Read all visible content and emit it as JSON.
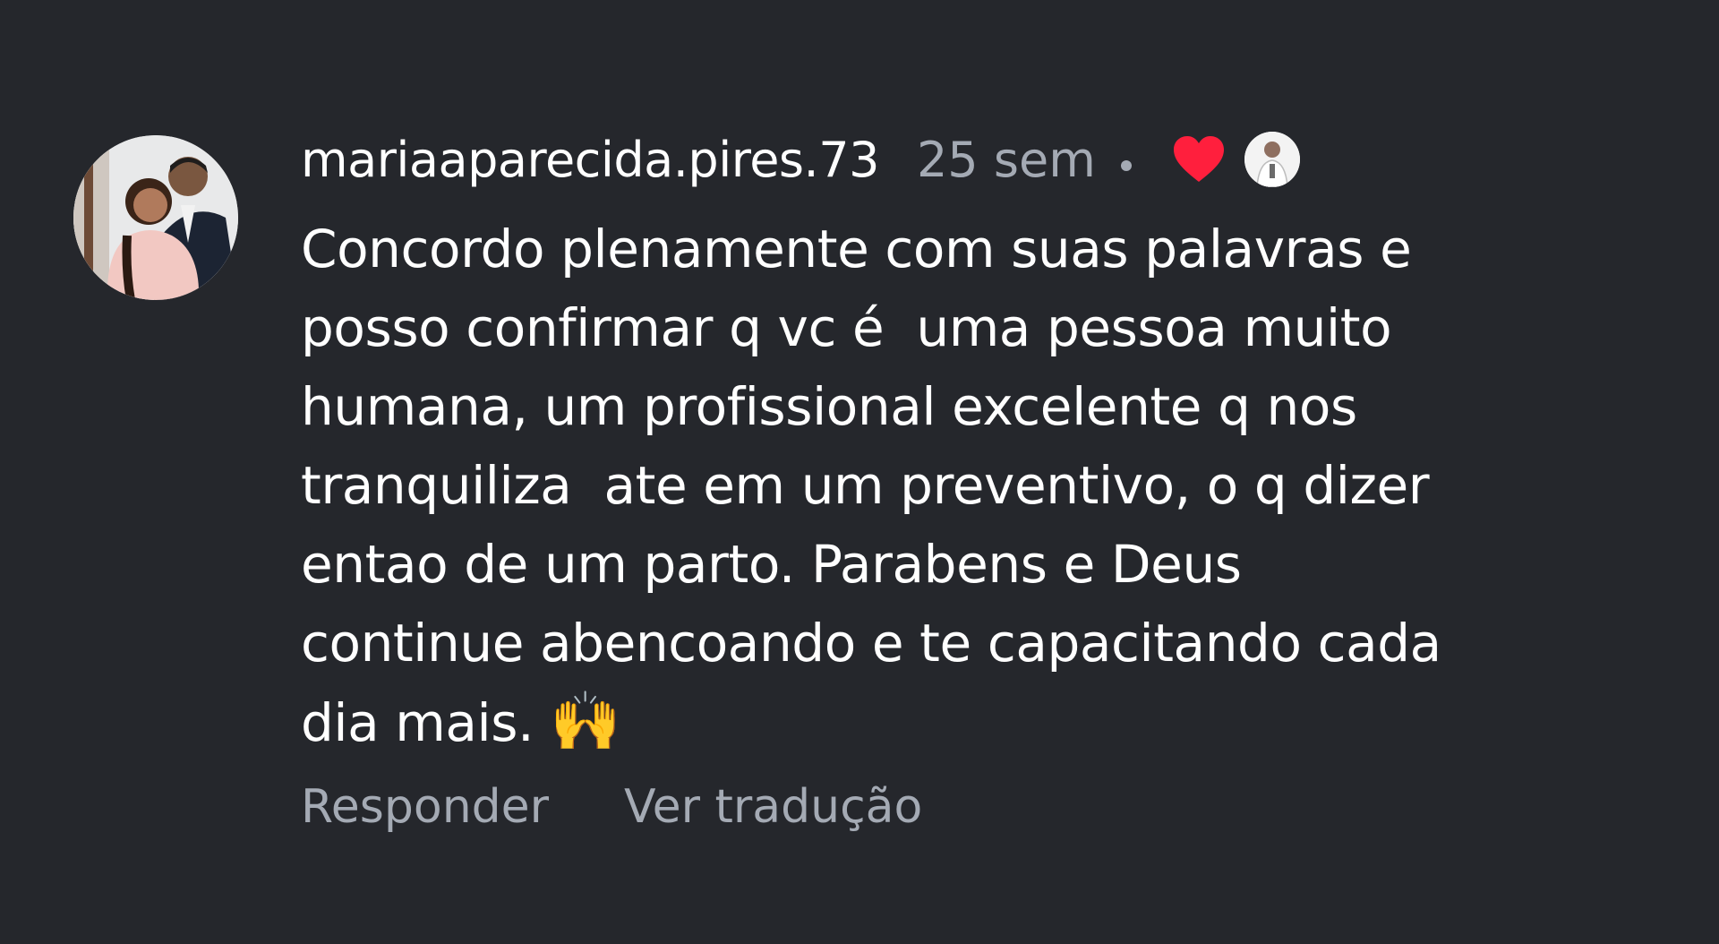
{
  "comment": {
    "username": "mariaaparecida.pires.73",
    "time": "25 sem",
    "text_lines": [
      "Concordo plenamente com suas palavras e",
      "posso confirmar q vc é  uma pessoa muito",
      "humana, um profissional excelente q nos",
      "tranquiliza  ate em um preventivo, o q dizer",
      "entao de um parto. Parabens e Deus",
      "continue abencoando e te capacitando cada",
      "dia mais. "
    ],
    "emoji": "🙌",
    "liked_by_author": true,
    "heart_color": "#ff1f3d"
  },
  "actions": {
    "reply_label": "Responder",
    "translate_label": "Ver tradução"
  },
  "icons": {
    "avatar": "user-avatar-photo",
    "heart": "heart-icon",
    "liker_avatar": "author-avatar-photo"
  },
  "colors": {
    "background": "#25272c",
    "primary_text": "#ffffff",
    "secondary_text": "#a4aab4"
  }
}
